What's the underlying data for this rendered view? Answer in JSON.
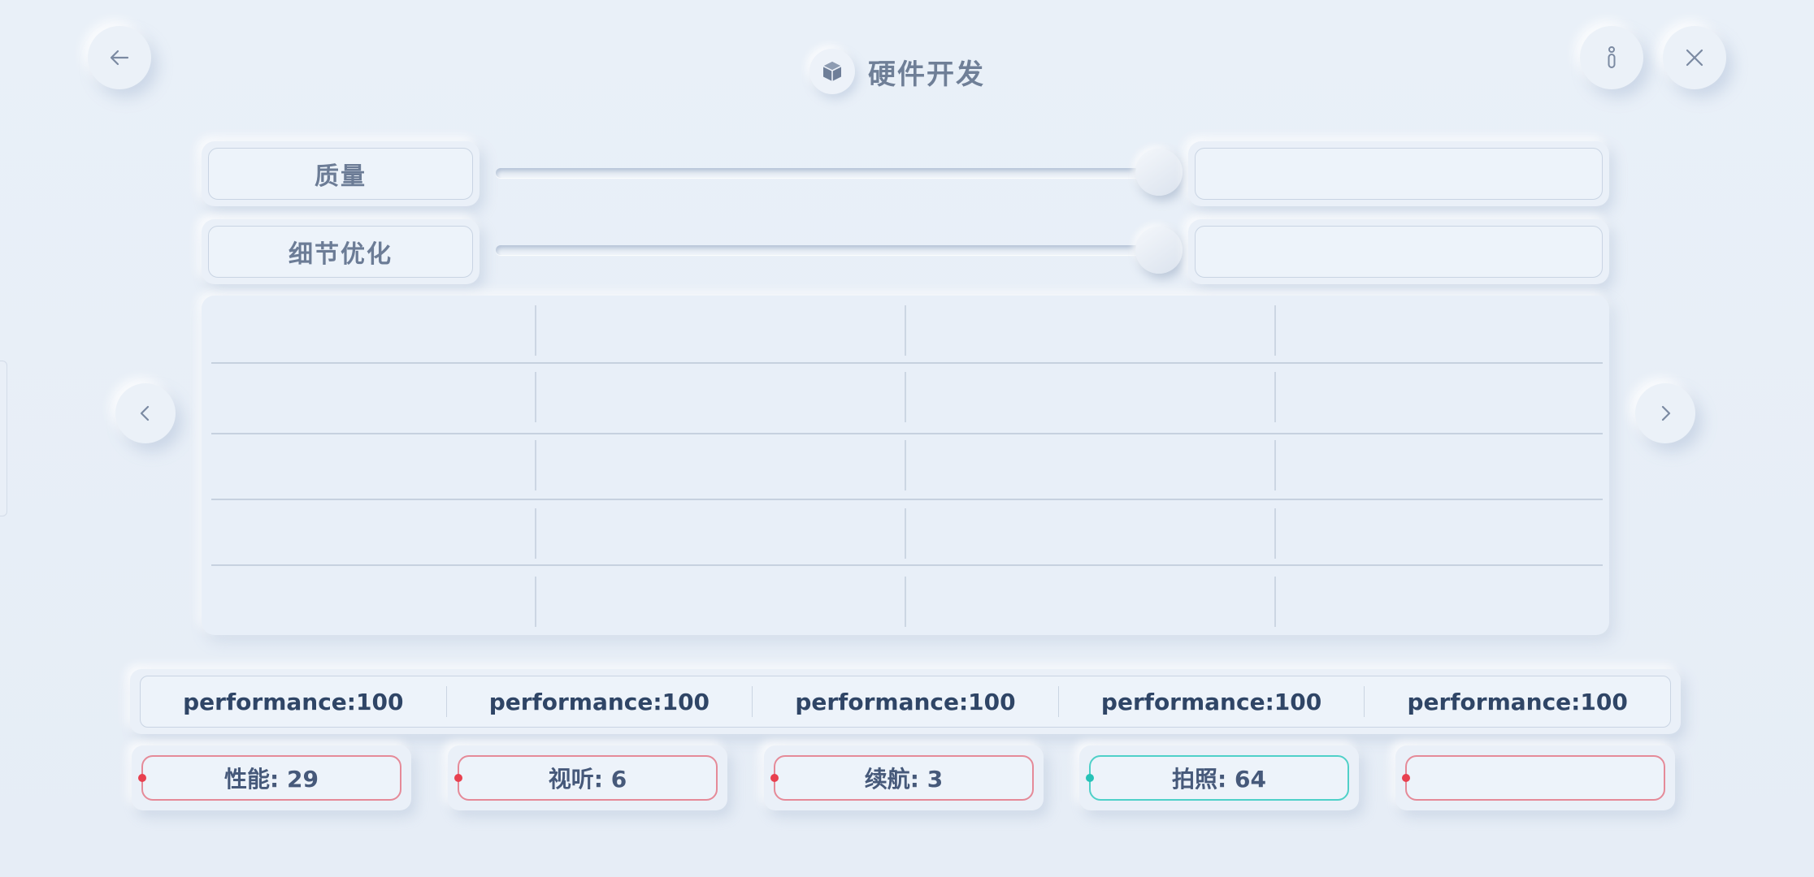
{
  "header": {
    "title": "硬件开发",
    "icons": {
      "back": "arrow-left-icon",
      "info": "info-icon",
      "close": "close-icon",
      "title": "cube-icon"
    }
  },
  "sliders": [
    {
      "label": "质量",
      "value": "",
      "level": 1.0
    },
    {
      "label": "细节优化",
      "value": "",
      "level": 1.0
    }
  ],
  "grid": {
    "rows": [
      [
        "",
        "",
        "",
        ""
      ],
      [
        "",
        "",
        "",
        ""
      ],
      [
        "",
        "",
        "",
        ""
      ],
      [
        "",
        "",
        "",
        ""
      ],
      [
        "",
        "",
        "",
        ""
      ]
    ]
  },
  "nav": {
    "prev_icon": "chevron-left-icon",
    "next_icon": "chevron-right-icon"
  },
  "performance": [
    "performance:100",
    "performance:100",
    "performance:100",
    "performance:100",
    "performance:100"
  ],
  "stats": [
    {
      "text": "性能: 29",
      "status": "red"
    },
    {
      "text": "视听: 6",
      "status": "red"
    },
    {
      "text": "续航: 3",
      "status": "red"
    },
    {
      "text": "拍照: 64",
      "status": "teal"
    },
    {
      "text": "",
      "status": "red"
    }
  ],
  "colors": {
    "accent_red": "#e8404f",
    "accent_teal": "#27c2b7",
    "text_dark": "#2f4566"
  }
}
